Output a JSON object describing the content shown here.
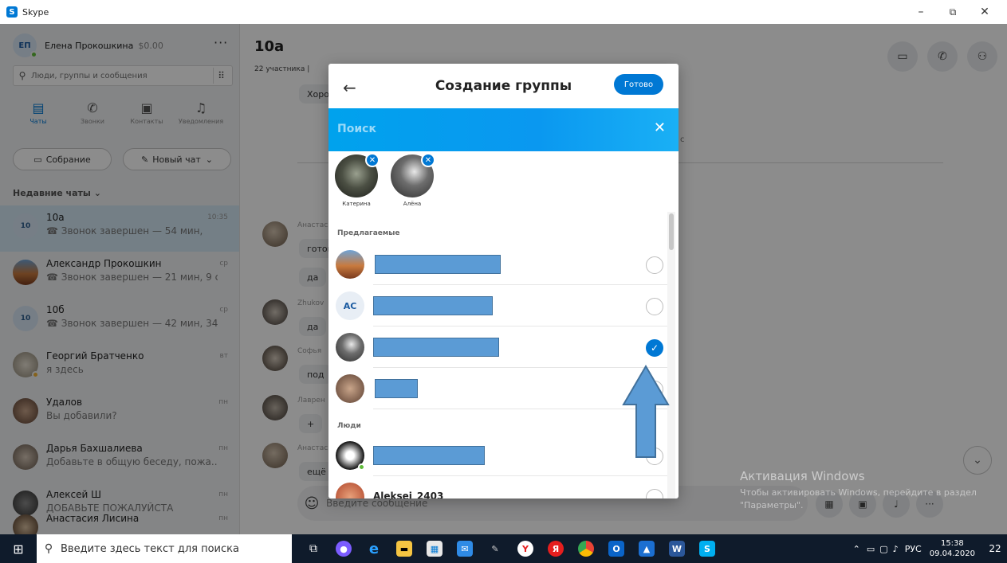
{
  "window": {
    "app_name": "Skype",
    "minimize": "–",
    "restore": "⧉",
    "close": "✕"
  },
  "profile": {
    "initials": "ЕП",
    "name": "Елена Прокошкина",
    "credit": "$0.00",
    "more": "···"
  },
  "search": {
    "placeholder": "Люди, группы и сообщения"
  },
  "nav": [
    {
      "label": "Чаты"
    },
    {
      "label": "Звонки"
    },
    {
      "label": "Контакты"
    },
    {
      "label": "Уведомления"
    }
  ],
  "buttons": {
    "meeting": "Собрание",
    "new_chat": "Новый чат"
  },
  "recent_header": "Недавние чаты",
  "chats": [
    {
      "avatar": "10",
      "name": "10а",
      "sub": "☎ Звонок завершен — 54 мин,",
      "time": "10:35"
    },
    {
      "avatar": "",
      "name": "Александр Прокошкин",
      "sub": "☎ Звонок завершен — 21 мин, 9 с",
      "time": "ср"
    },
    {
      "avatar": "10",
      "name": "10б",
      "sub": "☎ Звонок завершен — 42 мин, 34",
      "time": "ср"
    },
    {
      "avatar": "",
      "name": "Георгий Братченко",
      "sub": "я здесь",
      "time": "вт"
    },
    {
      "avatar": "",
      "name": "Удалов",
      "sub": "Вы добавили?",
      "time": "пн"
    },
    {
      "avatar": "",
      "name": "Дарья Бахшалиева",
      "sub": "Добавьте в общую беседу, пожа...",
      "time": "пн"
    },
    {
      "avatar": "",
      "name": "Алексей Ш",
      "sub": "ДОБАВЬТЕ ПОЖАЛУЙСТА",
      "time": "пн"
    },
    {
      "avatar": "",
      "name": "Анастасия Лисина",
      "sub": "",
      "time": "пн"
    }
  ],
  "conversation": {
    "title": "10а",
    "subtitle": "22 участника |",
    "messages": [
      {
        "author": "",
        "text": "Хоро"
      },
      {
        "author": "Анастас",
        "text": "готов"
      },
      {
        "author": "",
        "text": "да"
      },
      {
        "author": "Zhukov",
        "text": "да"
      },
      {
        "author": "Софья",
        "text": "под"
      },
      {
        "author": "Лаврен",
        "text": "+"
      },
      {
        "author": "Анастас",
        "text": "ещё"
      }
    ],
    "compose_placeholder": "Введите сообщение",
    "stray_char": "с"
  },
  "watermark": {
    "line1": "Активация Windows",
    "line2": "Чтобы активировать Windows, перейдите в раздел \"Параметры\"."
  },
  "modal": {
    "back": "←",
    "title": "Создание группы",
    "done": "Готово",
    "search_placeholder": "Поиск",
    "selected": [
      {
        "name": "Катерина"
      },
      {
        "name": "Алёна"
      }
    ],
    "suggested_header": "Предлагаемые",
    "people_header": "Люди",
    "suggested": [
      {
        "avatar_initials": "",
        "checked": false
      },
      {
        "avatar_initials": "AC",
        "checked": false
      },
      {
        "avatar_initials": "",
        "checked": true
      },
      {
        "avatar_initials": "",
        "checked": false
      }
    ],
    "people": [
      {
        "name": "",
        "checked": false
      },
      {
        "name": "Aleksei_2403",
        "checked": false
      }
    ]
  },
  "taskbar": {
    "search_placeholder": "Введите здесь текст для поиска",
    "lang": "РУС",
    "time": "15:38",
    "date": "09.04.2020",
    "notifications": "22"
  }
}
